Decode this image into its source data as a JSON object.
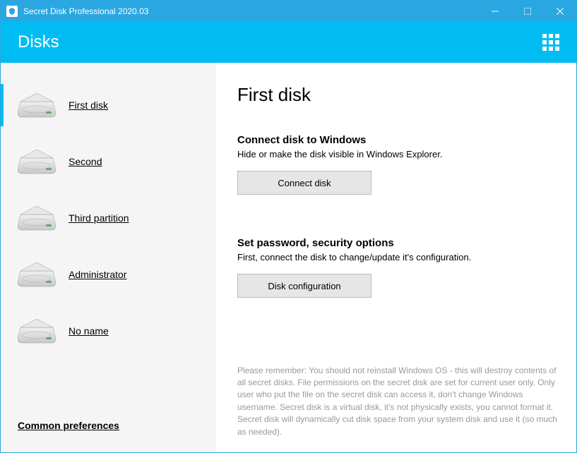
{
  "titlebar": {
    "title": "Secret Disk Professional 2020.03"
  },
  "header": {
    "title": "Disks"
  },
  "sidebar": {
    "items": [
      {
        "label": "First disk",
        "selected": true
      },
      {
        "label": "Second",
        "selected": false
      },
      {
        "label": "Third partition",
        "selected": false
      },
      {
        "label": "Administrator",
        "selected": false
      },
      {
        "label": "No name",
        "selected": false
      }
    ],
    "common_prefs": "Common preferences"
  },
  "main": {
    "heading": "First disk",
    "section1": {
      "title": "Connect disk to Windows",
      "desc": "Hide or make the disk visible in Windows Explorer.",
      "button": "Connect disk"
    },
    "section2": {
      "title": "Set password, security options",
      "desc": "First, connect the disk to change/update it's configuration.",
      "button": "Disk configuration"
    },
    "footer": "Please remember: You should not reinstall Windows OS - this will destroy contents of all secret disks. File permissions on the secret disk are set for current user only. Only user who put the file on the secret disk can access it, don't change Windows username. Secret disk is a virtual disk, it's not physically exists, you cannot format it. Secret disk will dynamically cut disk space from your system disk and use it (so much as needed)."
  }
}
